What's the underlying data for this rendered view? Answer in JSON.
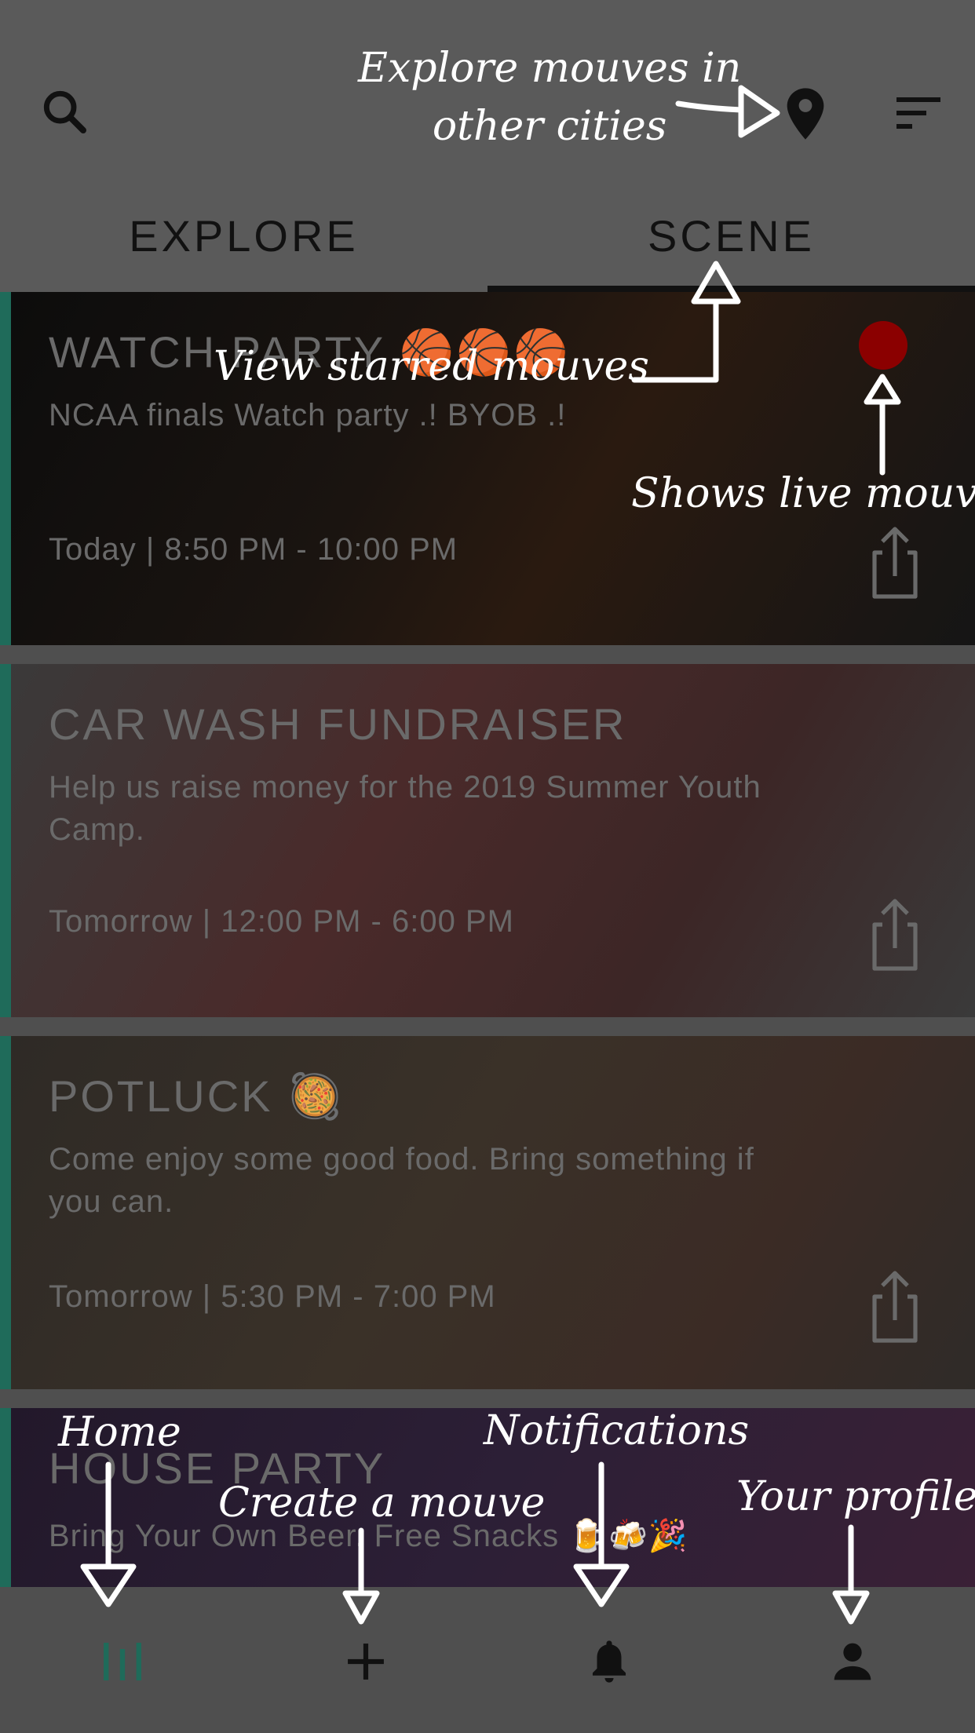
{
  "tabs": {
    "explore": "EXPLORE",
    "scene": "SCENE",
    "active": "SCENE"
  },
  "icons": {
    "search": "search-icon",
    "location": "location-pin-icon",
    "sort": "sort-icon",
    "share": "share-icon",
    "home": "home-icon",
    "create": "plus-icon",
    "notifications": "bell-icon",
    "profile": "person-icon"
  },
  "colors": {
    "accent": "#1f6b5a",
    "live": "#8b0000",
    "tab_text": "#111111"
  },
  "events": [
    {
      "title": "WATCH PARTY 🏀🏀🏀",
      "description": "NCAA finals Watch party .! BYOB .!",
      "time": "Today | 8:50 PM - 10:00 PM",
      "live": true
    },
    {
      "title": "CAR WASH FUNDRAISER",
      "description": "Help us raise money for the 2019 Summer Youth Camp.",
      "time": "Tomorrow | 12:00 PM - 6:00 PM",
      "live": false
    },
    {
      "title": "POTLUCK 🥘",
      "description": "Come enjoy some good food. Bring something if you can.",
      "time": "Tomorrow | 5:30 PM - 7:00 PM",
      "live": false
    },
    {
      "title": "HOUSE PARTY",
      "description": "Bring Your Own Beer. Free Snacks 🍺🍻🎉",
      "time": "",
      "live": false
    }
  ],
  "annotations": {
    "explore_cities": "Explore mouves in\nother cities",
    "starred": "View starred mouves",
    "live": "Shows live mouve",
    "home": "Home",
    "create": "Create a mouve",
    "notifications": "Notifications",
    "profile": "Your profile"
  }
}
